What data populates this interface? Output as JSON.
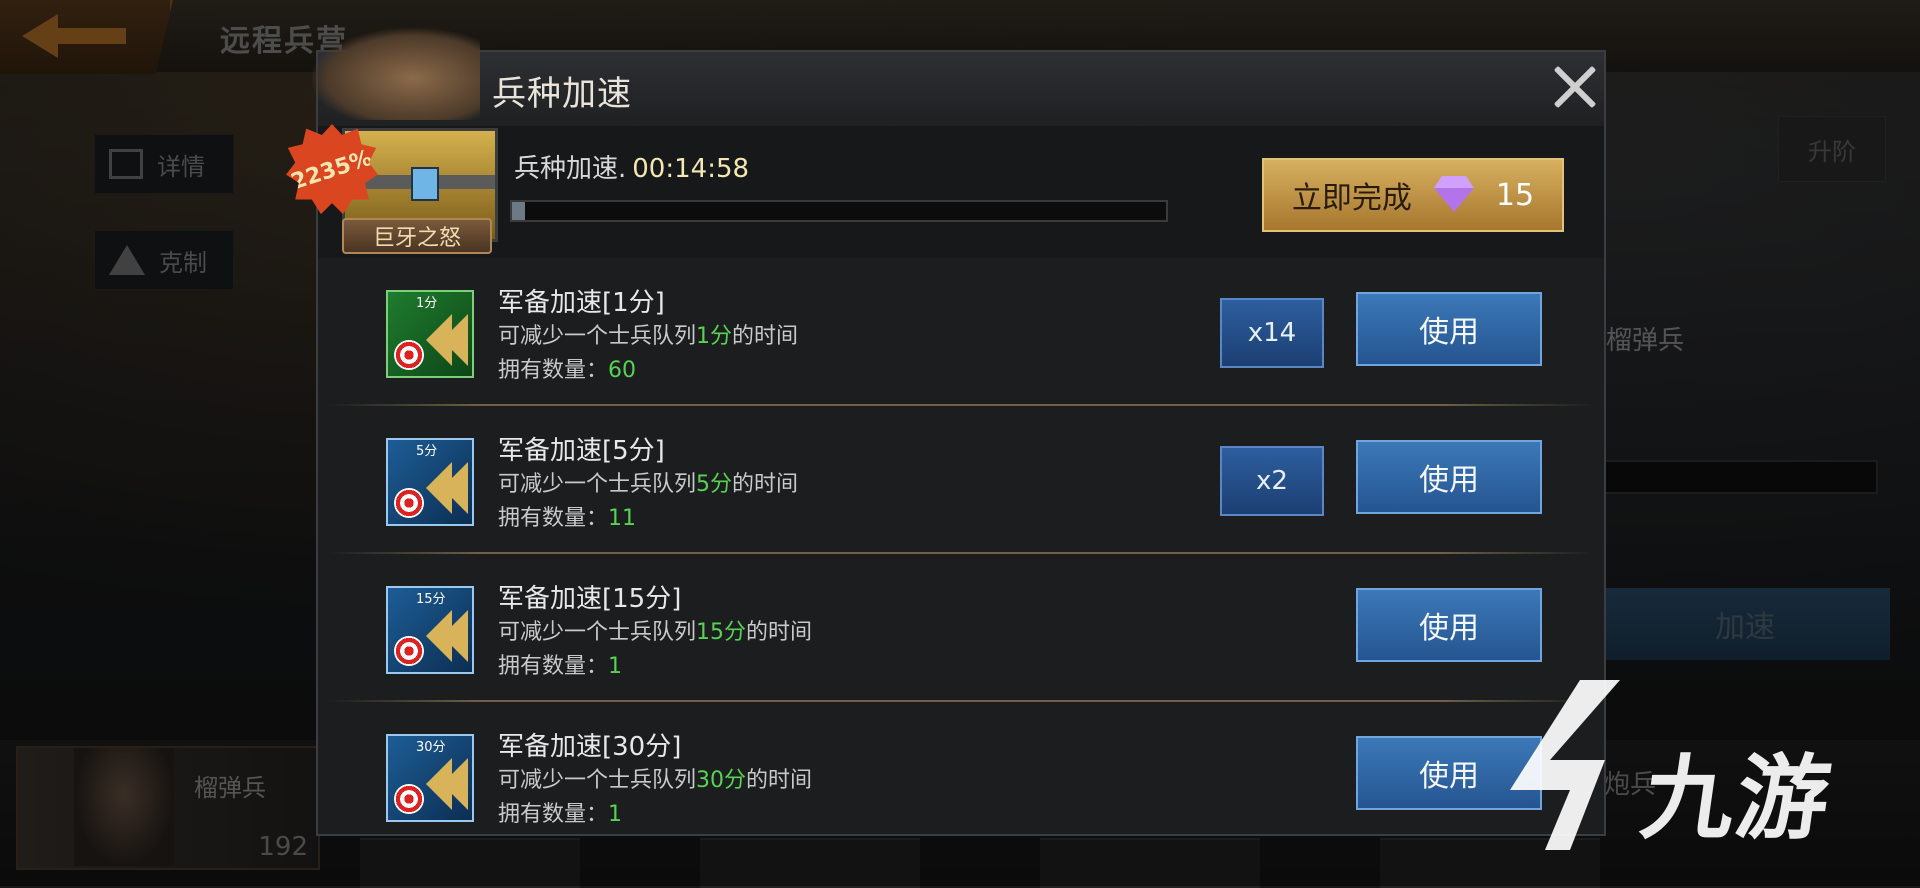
{
  "background": {
    "screen_title": "远程兵营",
    "side_buttons": [
      "详情",
      "克制"
    ],
    "upgrade_label": "升阶",
    "unit_name": "榴弹兵",
    "speedup_label": "加速",
    "portrait_name": "榴弹兵",
    "portrait_count": "192",
    "unit_name_2": "炮兵"
  },
  "dialog": {
    "title": "兵种加速",
    "event_badge": "2235%",
    "event_name": "巨牙之怒",
    "timer_label": "兵种加速.",
    "timer_value": "00:14:58",
    "timer_progress": 0.02,
    "finish_label": "立即完成",
    "finish_cost": "15",
    "items": [
      {
        "icon_tag": "1分",
        "icon_color": "green",
        "name": "军备加速[1分]",
        "desc_pre": "可减少一个士兵队列",
        "desc_hl": "1分",
        "desc_post": "的时间",
        "owned_label": "拥有数量：",
        "owned": "60",
        "multiplier": "x14",
        "use_label": "使用"
      },
      {
        "icon_tag": "5分",
        "icon_color": "blue",
        "name": "军备加速[5分]",
        "desc_pre": "可减少一个士兵队列",
        "desc_hl": "5分",
        "desc_post": "的时间",
        "owned_label": "拥有数量：",
        "owned": "11",
        "multiplier": "x2",
        "use_label": "使用"
      },
      {
        "icon_tag": "15分",
        "icon_color": "blue",
        "name": "军备加速[15分]",
        "desc_pre": "可减少一个士兵队列",
        "desc_hl": "15分",
        "desc_post": "的时间",
        "owned_label": "拥有数量：",
        "owned": "1",
        "multiplier": "",
        "use_label": "使用"
      },
      {
        "icon_tag": "30分",
        "icon_color": "blue",
        "name": "军备加速[30分]",
        "desc_pre": "可减少一个士兵队列",
        "desc_hl": "30分",
        "desc_post": "的时间",
        "owned_label": "拥有数量：",
        "owned": "1",
        "multiplier": "",
        "use_label": "使用"
      }
    ]
  },
  "watermark": {
    "text": "九游"
  },
  "colors": {
    "highlight_green": "#58d253",
    "gold_button": "#c99a44",
    "blue_button": "#2f66a6",
    "timer_text": "#f3e7b4"
  }
}
